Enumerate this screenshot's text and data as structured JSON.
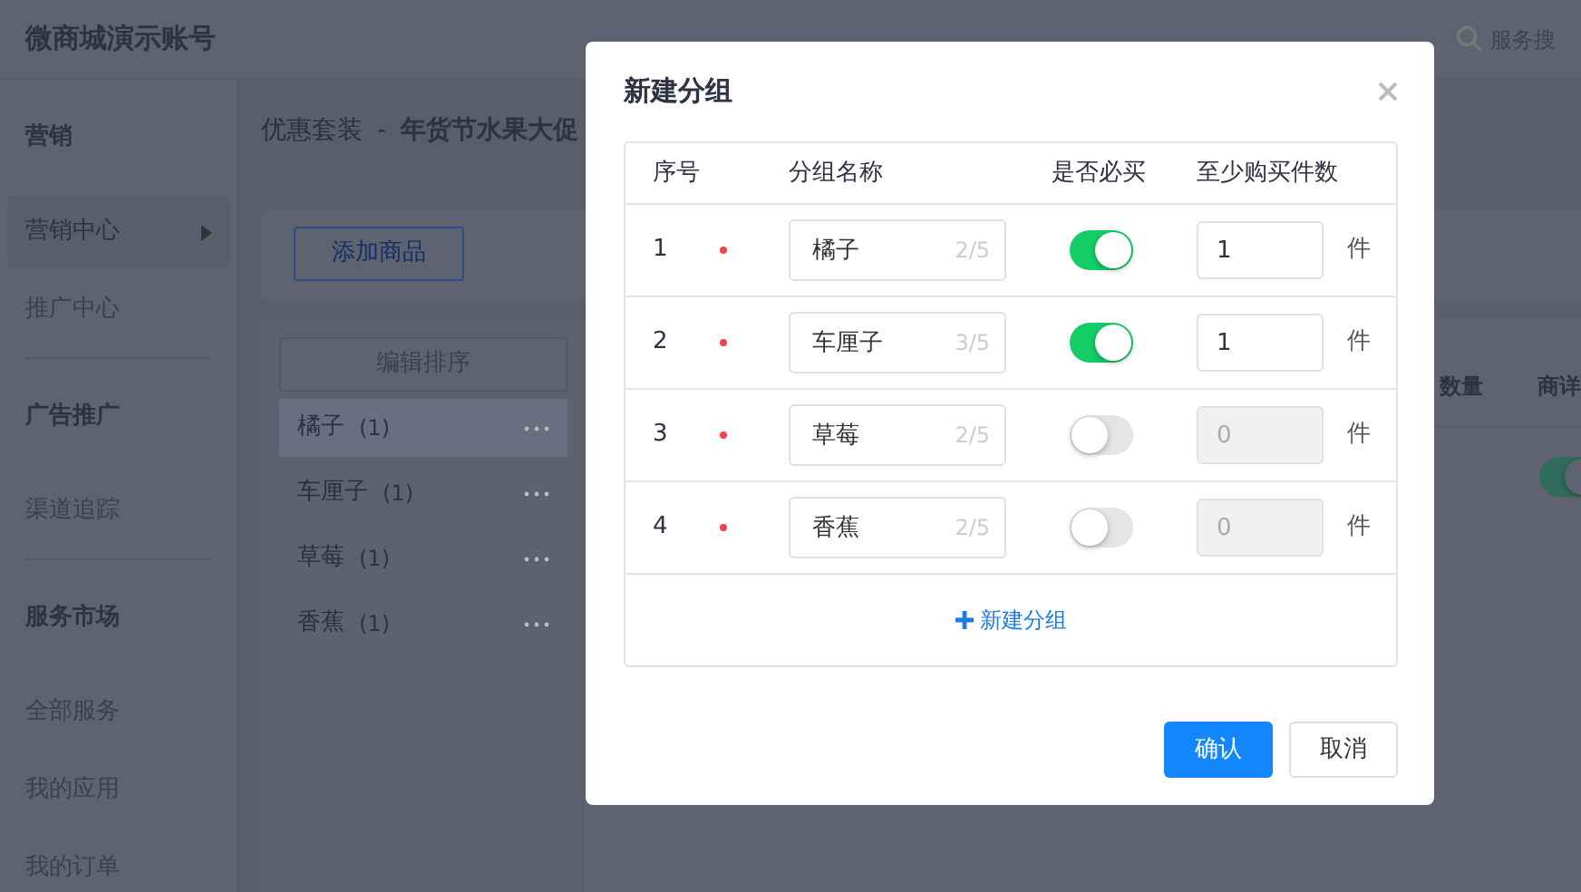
{
  "header": {
    "title": "微商城演示账号",
    "search_placeholder": "服务搜"
  },
  "sidebar": {
    "sections": [
      {
        "title": "营销",
        "items": [
          {
            "label": "营销中心",
            "selected": true
          },
          {
            "label": "推广中心",
            "selected": false
          }
        ]
      },
      {
        "title": "广告推广",
        "items": [
          {
            "label": "渠道追踪",
            "selected": false
          }
        ]
      },
      {
        "title": "服务市场",
        "items": [
          {
            "label": "全部服务",
            "selected": false
          },
          {
            "label": "我的应用",
            "selected": false
          },
          {
            "label": "我的订单",
            "selected": false
          }
        ]
      }
    ]
  },
  "breadcrumb": {
    "parent": "优惠套装",
    "separator": "-",
    "current": "年货节水果大促"
  },
  "add_button": "添加商品",
  "group_panel": {
    "sort_button": "编辑排序",
    "groups": [
      {
        "name": "橘子",
        "count": "(1)",
        "selected": true
      },
      {
        "name": "车厘子",
        "count": "(1)",
        "selected": false
      },
      {
        "name": "草莓",
        "count": "(1)",
        "selected": false
      },
      {
        "name": "香蕉",
        "count": "(1)",
        "selected": false
      }
    ]
  },
  "product_table": {
    "columns": [
      "数量",
      "商详"
    ],
    "rows": [
      {
        "detail_on": true
      }
    ]
  },
  "dialog": {
    "title": "新建分组",
    "columns": [
      "序号",
      "分组名称",
      "是否必买",
      "至少购买件数"
    ],
    "rows": [
      {
        "index": "1",
        "name": "橘子",
        "counter": "2/5",
        "required": true,
        "min_qty": "1",
        "unit": "件"
      },
      {
        "index": "2",
        "name": "车厘子",
        "counter": "3/5",
        "required": true,
        "min_qty": "1",
        "unit": "件"
      },
      {
        "index": "3",
        "name": "草莓",
        "counter": "2/5",
        "required": false,
        "min_qty": "0",
        "unit": "件"
      },
      {
        "index": "4",
        "name": "香蕉",
        "counter": "2/5",
        "required": false,
        "min_qty": "0",
        "unit": "件"
      }
    ],
    "add_group": "新建分组",
    "buttons": {
      "confirm": "确认",
      "cancel": "取消"
    }
  }
}
